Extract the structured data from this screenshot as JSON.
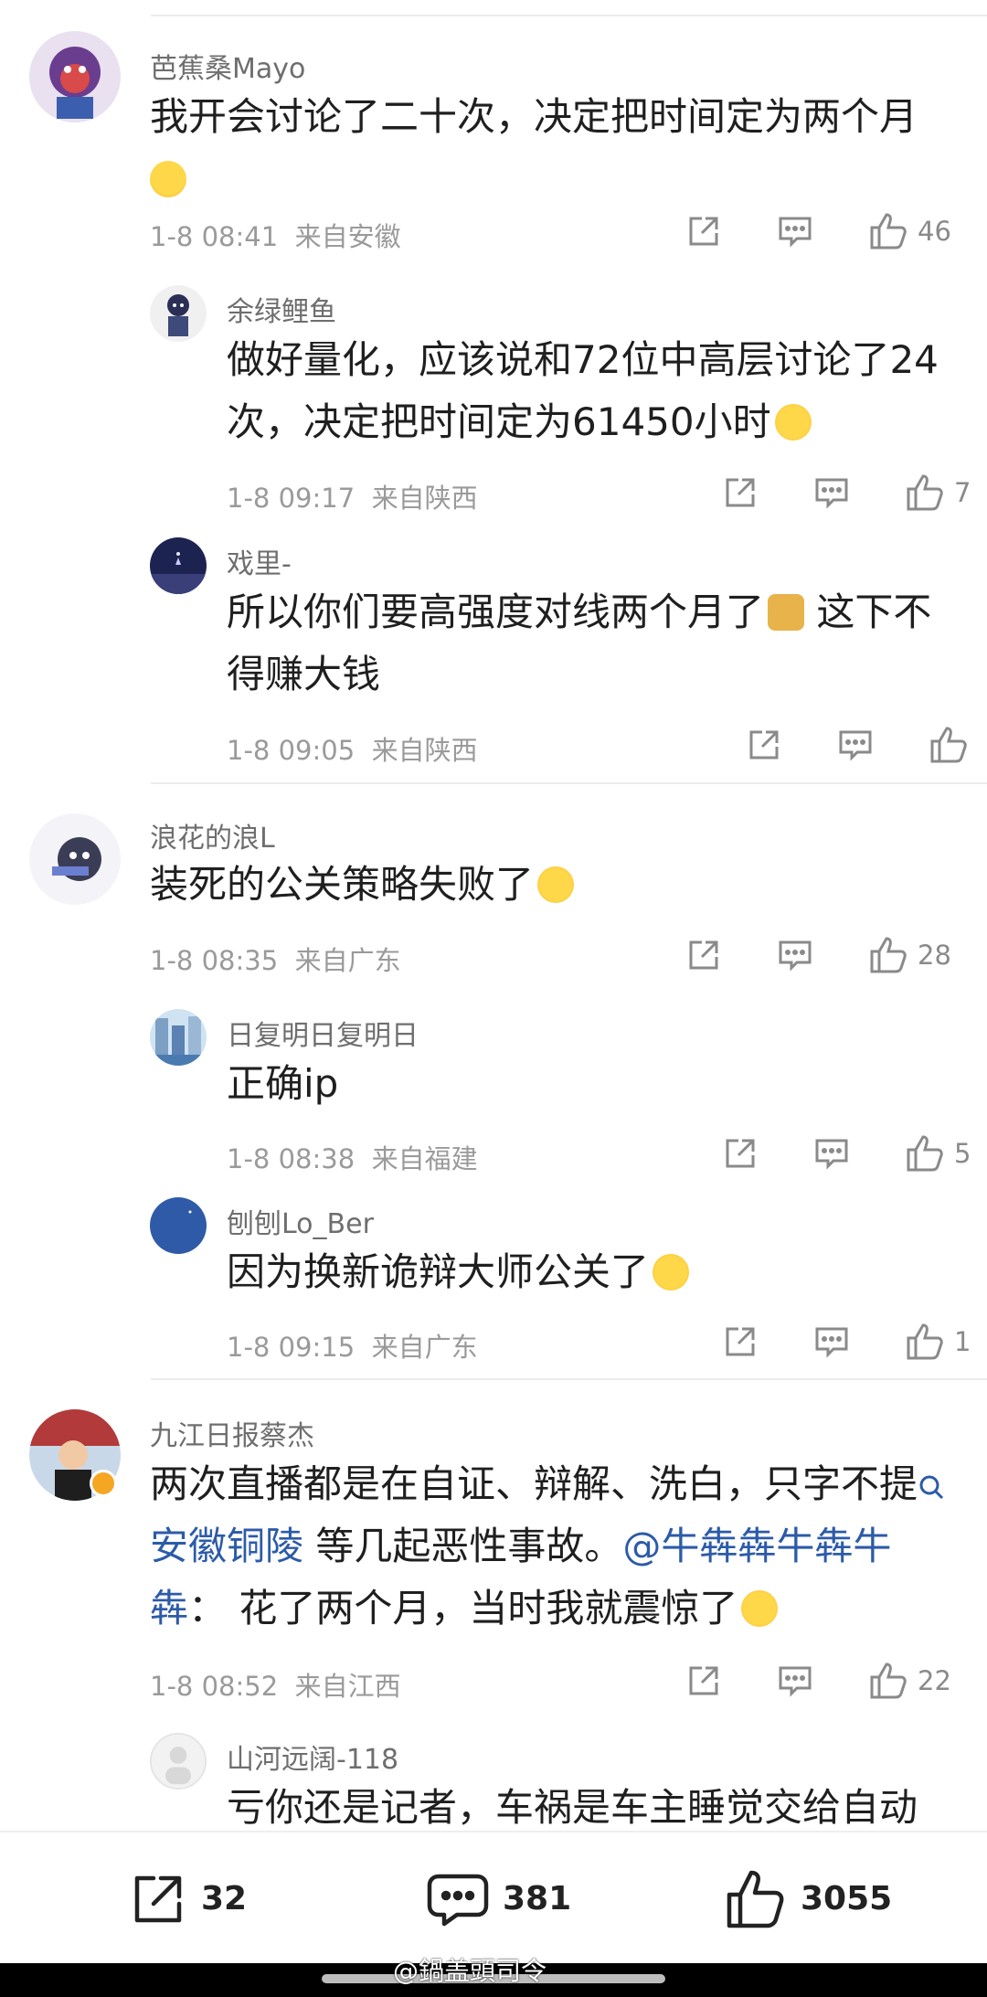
{
  "comments": [
    {
      "username": "芭蕉桑Mayo",
      "text": "我开会讨论了二十次，决定把时间定为两个月",
      "time": "1-8 08:41",
      "location": "来自安徽",
      "likes": "46",
      "replies": [
        {
          "username": "余绿鲤鱼",
          "text": "做好量化，应该说和72位中高层讨论了24次，决定把时间定为61450小时",
          "time": "1-8 09:17",
          "location": "来自陕西",
          "likes": "7"
        },
        {
          "username": "戏里-",
          "text": "所以你们要高强度对线两个月了",
          "text_tail": " 这下不得赚大钱",
          "time": "1-8 09:05",
          "location": "来自陕西",
          "likes": ""
        }
      ]
    },
    {
      "username": "浪花的浪L",
      "text": "装死的公关策略失败了",
      "time": "1-8 08:35",
      "location": "来自广东",
      "likes": "28",
      "replies": [
        {
          "username": "日复明日复明日",
          "text": "正确ip",
          "time": "1-8 08:38",
          "location": "来自福建",
          "likes": "5"
        },
        {
          "username": "刨刨Lo_Ber",
          "text": "因为换新诡辩大师公关了",
          "time": "1-8 09:15",
          "location": "来自广东",
          "likes": "1"
        }
      ]
    },
    {
      "username": "九江日报蔡杰",
      "text_part1": "两次直播都是在自证、辩解、洗白，只字不提",
      "topic_link": "安徽铜陵",
      "text_part2": " 等几起恶性事故。",
      "mention_link": "@牛犇犇牛犇牛犇",
      "text_part3": "： 花了两个月，当时我就震惊了",
      "time": "1-8 08:52",
      "location": "来自江西",
      "likes": "22",
      "replies": [
        {
          "username": "山河远阔-118",
          "text": "亏你还是记者，车祸是车主睡觉交给自动"
        }
      ]
    }
  ],
  "bottom_bar": {
    "share_count": "32",
    "comment_count": "381",
    "like_count": "3055"
  },
  "watermark": "@鍋盖頭司令"
}
